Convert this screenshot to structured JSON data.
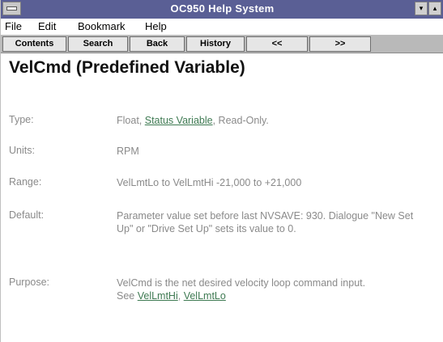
{
  "window": {
    "title": "OC950 Help System"
  },
  "titlebar_buttons": {
    "minimize": "▾",
    "maximize": "▴"
  },
  "menu": {
    "file": "File",
    "edit": "Edit",
    "bookmark": "Bookmark",
    "help": "Help"
  },
  "toolbar": {
    "contents": "Contents",
    "search": "Search",
    "back": "Back",
    "history": "History",
    "prev": "<<",
    "next": ">>"
  },
  "topic": {
    "heading": "VelCmd (Predefined Variable)",
    "type": {
      "label": "Type:",
      "pre": "Float, ",
      "link": "Status Variable",
      "post": ", Read-Only."
    },
    "units": {
      "label": "Units:",
      "value": "RPM"
    },
    "range": {
      "label": "Range:",
      "value": "VelLmtLo to VelLmtHi -21,000 to +21,000"
    },
    "default": {
      "label": "Default:",
      "value": "Parameter value set before last NVSAVE: 930. Dialogue \"New Set Up\" or \"Drive Set Up\" sets its value to 0."
    },
    "purpose": {
      "label": "Purpose:",
      "value": "VelCmd is the net desired velocity loop command input.",
      "see_label": "See ",
      "see_link_1": "VelLmtHi",
      "see_sep": ", ",
      "see_link_2": "VelLmtLo"
    }
  }
}
